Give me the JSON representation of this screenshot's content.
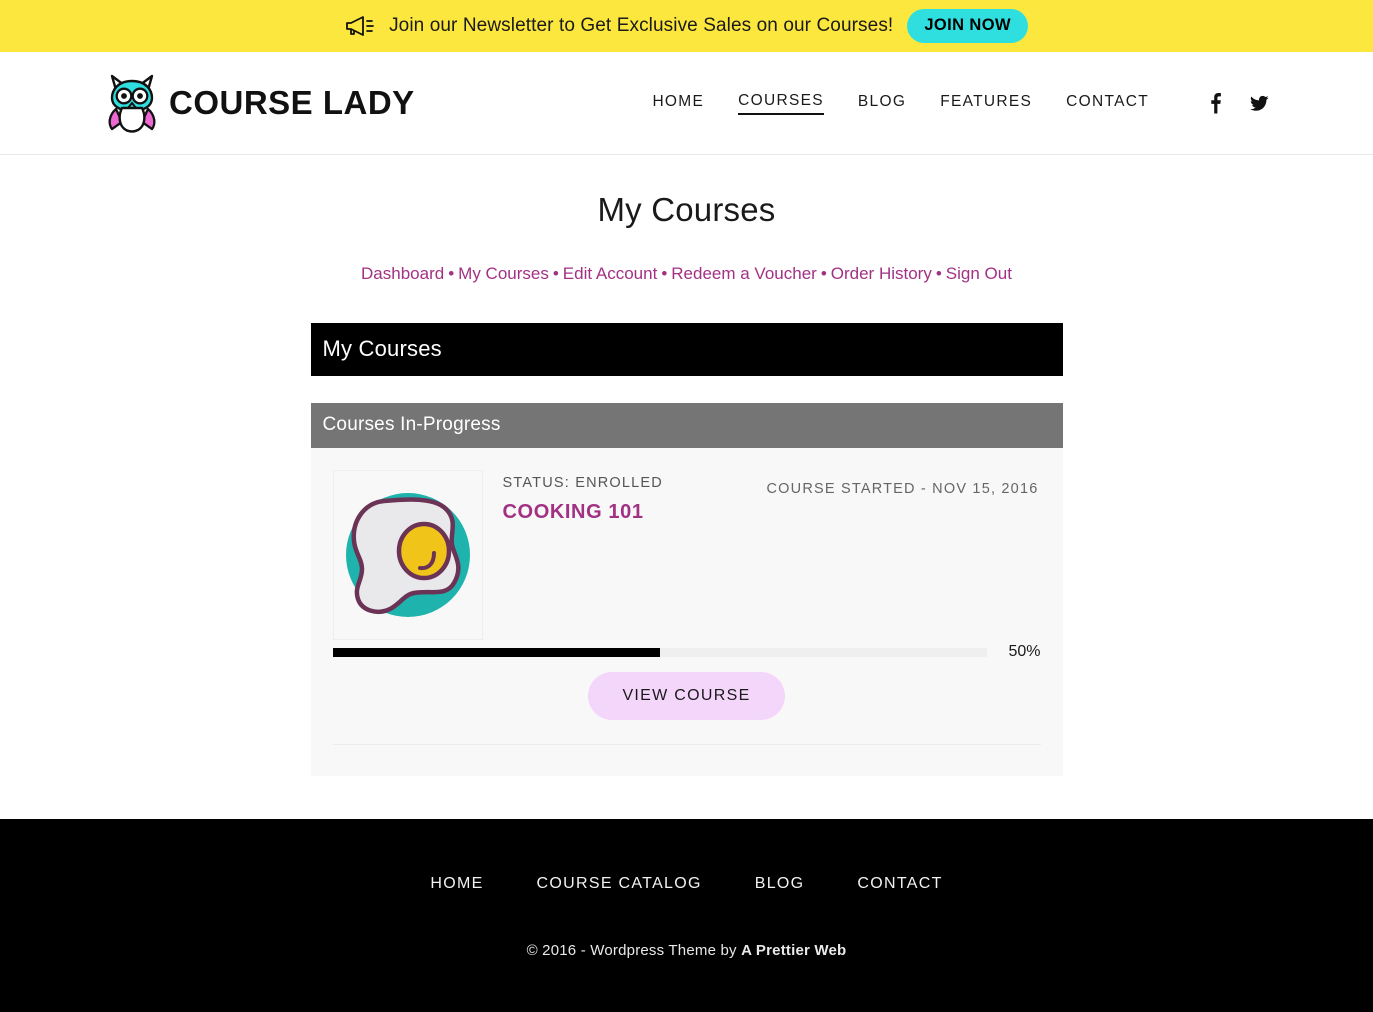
{
  "announcement": {
    "icon": "megaphone-icon",
    "text": "Join our Newsletter to Get Exclusive Sales on our Courses!",
    "cta_label": "JOIN NOW",
    "bg_color": "#FCE73E",
    "cta_color": "#2FDFDF"
  },
  "header": {
    "logo_text": "COURSE LADY",
    "logo_icon": "owl-logo-icon",
    "nav": [
      {
        "label": "HOME",
        "active": false
      },
      {
        "label": "COURSES",
        "active": true
      },
      {
        "label": "BLOG",
        "active": false
      },
      {
        "label": "FEATURES",
        "active": false
      },
      {
        "label": "CONTACT",
        "active": false
      }
    ],
    "social": [
      {
        "icon": "facebook-icon",
        "name": "Facebook"
      },
      {
        "icon": "twitter-icon",
        "name": "Twitter"
      }
    ]
  },
  "main": {
    "page_title": "My Courses",
    "account_nav": [
      "Dashboard",
      "My Courses",
      "Edit Account",
      "Redeem a Voucher",
      "Order History",
      "Sign Out"
    ],
    "account_nav_separator": "•",
    "accent_color": "#A23184",
    "panel_title": "My Courses",
    "section_title": "Courses In-Progress",
    "courses": [
      {
        "thumbnail_icon": "fried-egg-icon",
        "status": "STATUS: ENROLLED",
        "name": "COOKING 101",
        "started": "COURSE STARTED - NOV 15, 2016",
        "progress_percent": 50,
        "progress_label": "50%",
        "button_label": "VIEW COURSE"
      }
    ]
  },
  "footer": {
    "nav": [
      "HOME",
      "COURSE CATALOG",
      "BLOG",
      "CONTACT"
    ],
    "credit_prefix": "© 2016 - Wordpress Theme by ",
    "credit_brand": "A Prettier Web"
  }
}
